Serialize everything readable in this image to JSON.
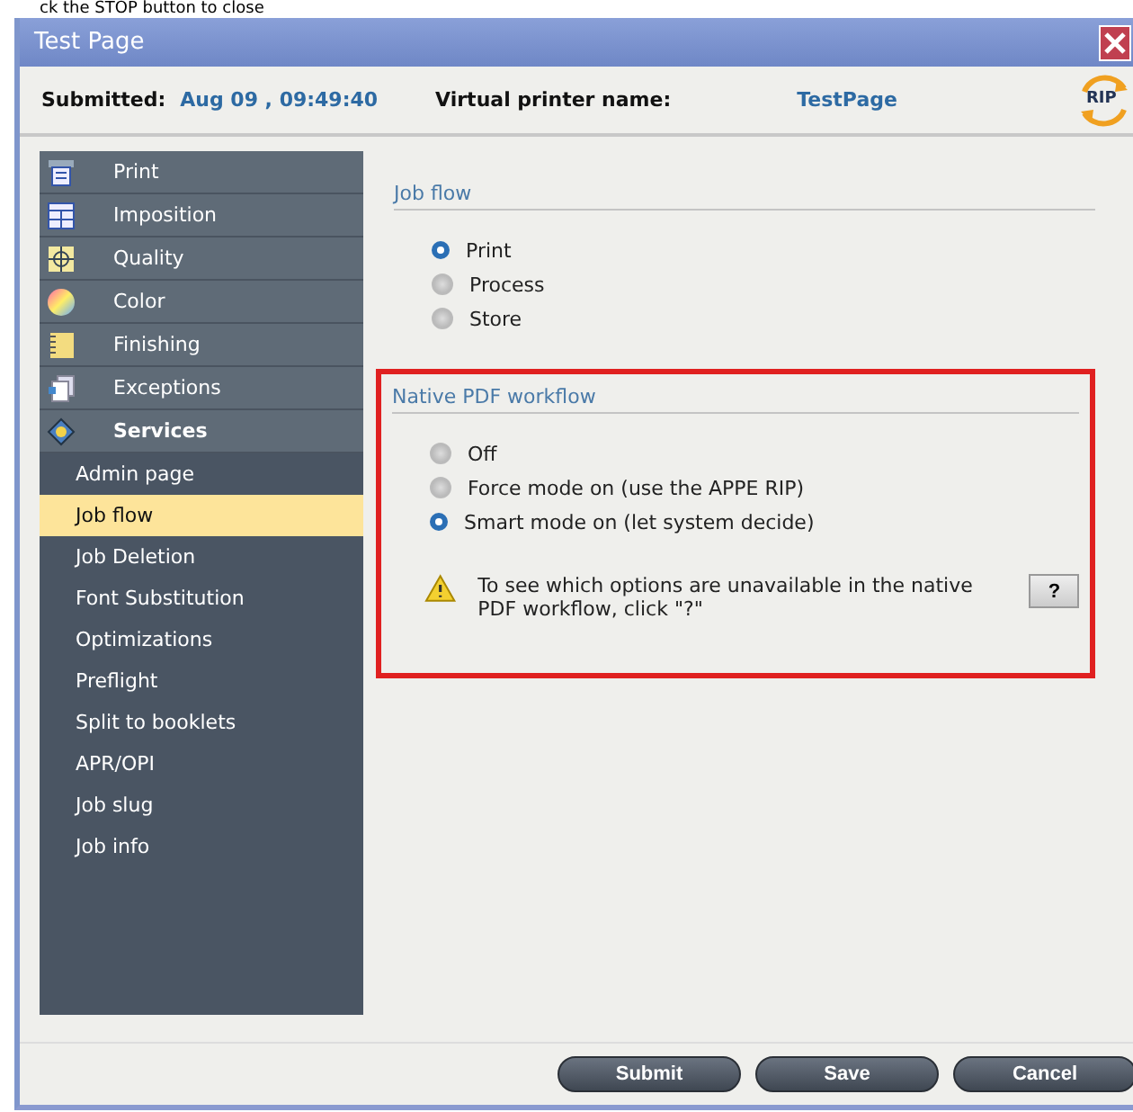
{
  "background_text": "ck the STOP button to close",
  "window": {
    "title": "Test Page"
  },
  "header": {
    "submitted_label": "Submitted:",
    "submitted_value": "Aug 09 , 09:49:40",
    "printer_label": "Virtual printer name:",
    "printer_value": "TestPage",
    "rip_badge": "RIP"
  },
  "sidebar": {
    "items": [
      {
        "label": "Print",
        "expanded": false,
        "selected": false
      },
      {
        "label": "Imposition",
        "expanded": false,
        "selected": false
      },
      {
        "label": "Quality",
        "expanded": false,
        "selected": false
      },
      {
        "label": "Color",
        "expanded": false,
        "selected": false
      },
      {
        "label": "Finishing",
        "expanded": false,
        "selected": false
      },
      {
        "label": "Exceptions",
        "expanded": false,
        "selected": false
      },
      {
        "label": "Services",
        "expanded": true,
        "selected": false,
        "children": [
          {
            "label": "Admin page",
            "selected": false
          },
          {
            "label": "Job flow",
            "selected": true
          },
          {
            "label": "Job Deletion",
            "selected": false
          },
          {
            "label": "Font Substitution",
            "selected": false
          },
          {
            "label": "Optimizations",
            "selected": false
          },
          {
            "label": "Preflight",
            "selected": false
          },
          {
            "label": "Split to booklets",
            "selected": false
          },
          {
            "label": "APR/OPI",
            "selected": false
          },
          {
            "label": "Job slug",
            "selected": false
          },
          {
            "label": "Job info",
            "selected": false
          }
        ]
      }
    ]
  },
  "sections": [
    {
      "title": "Job flow",
      "highlighted": false,
      "options": [
        {
          "label": "Print",
          "selected": true
        },
        {
          "label": "Process",
          "selected": false
        },
        {
          "label": "Store",
          "selected": false
        }
      ]
    },
    {
      "title": "Native PDF workflow",
      "highlighted": true,
      "options": [
        {
          "label": "Off",
          "selected": false
        },
        {
          "label": "Force mode on (use the APPE RIP)",
          "selected": false
        },
        {
          "label": "Smart mode on (let system decide)",
          "selected": true
        }
      ],
      "warning": {
        "text": "To see which options are unavailable in the native PDF workflow, click \"?\"",
        "button": "?"
      }
    }
  ],
  "buttons": [
    "Submit",
    "Save",
    "Cancel"
  ]
}
